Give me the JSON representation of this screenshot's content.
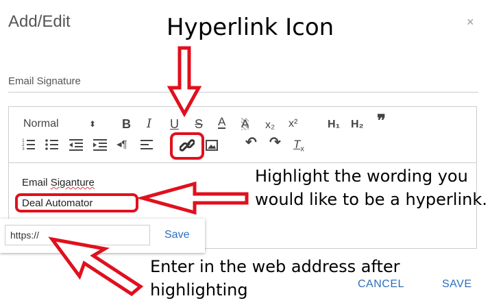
{
  "dialog": {
    "title": "Add/Edit",
    "close_glyph": "×"
  },
  "annotations": {
    "hyperlink_title": "Hyperlink Icon",
    "highlight_note": "Highlight the wording you would like to be a hyperlink.",
    "enter_note": "Enter in the web address after highlighting"
  },
  "field": {
    "label": "Email Signature"
  },
  "toolbar": {
    "format_select": "Normal",
    "bold": "B",
    "italic": "I",
    "underline": "U",
    "strike": "S",
    "font_color": "A",
    "background": "A",
    "subscript": "x₂",
    "superscript": "x²",
    "h1": "H₁",
    "h2": "H₂",
    "blockquote": "❞",
    "icons": [
      "ordered-list-icon",
      "bullet-list-icon",
      "outdent-icon",
      "indent-icon",
      "rtl-icon",
      "align-icon",
      "link-icon",
      "image-icon",
      "undo-icon",
      "redo-icon",
      "clear-format-icon"
    ]
  },
  "editor": {
    "line1_prefix": "Email ",
    "line1_word": "Siganture",
    "line2": "Deal Automator"
  },
  "link_popup": {
    "value": "https://",
    "save_label": "Save"
  },
  "footer": {
    "cancel_label": "CANCEL",
    "save_label": "SAVE"
  },
  "colors": {
    "accent_blue": "#2a6ebb",
    "annotation_red": "#e0101e"
  }
}
